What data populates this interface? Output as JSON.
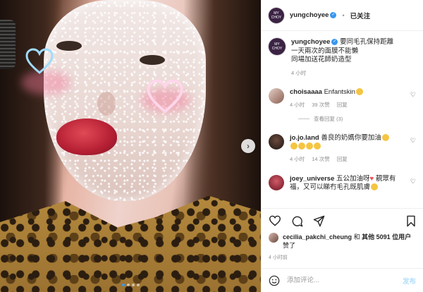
{
  "header": {
    "avatar_text_top": "MY",
    "avatar_text_bottom": "CHOY",
    "username": "yungchoyee",
    "verified_glyph": "✓",
    "separator": "•",
    "follow_label": "已关注"
  },
  "caption": {
    "username": "yungchoyee",
    "lines": [
      "要同毛孔保持距離",
      "一天兩次的面膜不能懶",
      "同場加送花師奶造型"
    ],
    "time": "4 小时"
  },
  "comments": [
    {
      "username": "choisaaaa",
      "text": "Enfantskin",
      "emoji": "smiling-face",
      "time": "4 小时",
      "likes": "39 次赞",
      "reply": "回复",
      "avatar_color": "#c8a89c",
      "view_replies": "查看回复 (3)"
    },
    {
      "username": "jo.jo.land",
      "text": "善良的奶媽你要加油",
      "emoji_count": 4,
      "time": "4 小时",
      "likes": "14 次赞",
      "reply": "回复",
      "avatar_color": "#2b1f1a"
    },
    {
      "username": "joey_universe",
      "text": "五公加油呀",
      "text2": "靚眾有福，又可以睇冇毛孔既肌膚",
      "avatar_color": "#b0283a"
    }
  ],
  "actions": {
    "icons": [
      "heart-icon",
      "comment-icon",
      "share-icon",
      "bookmark-icon"
    ]
  },
  "likes": {
    "user": "cecilia_pakchi_cheung",
    "and": "和",
    "others": "其他 5091 位用户",
    "suffix": "赞了"
  },
  "post_time": "4 小时前",
  "add_comment": {
    "placeholder": "添加评论...",
    "post_label": "发布"
  },
  "colors": {
    "accent": "#3897f0",
    "post_disabled": "#b2dffc",
    "muted": "#8e8e8e"
  },
  "carousel": {
    "total": 4,
    "active": 1
  }
}
